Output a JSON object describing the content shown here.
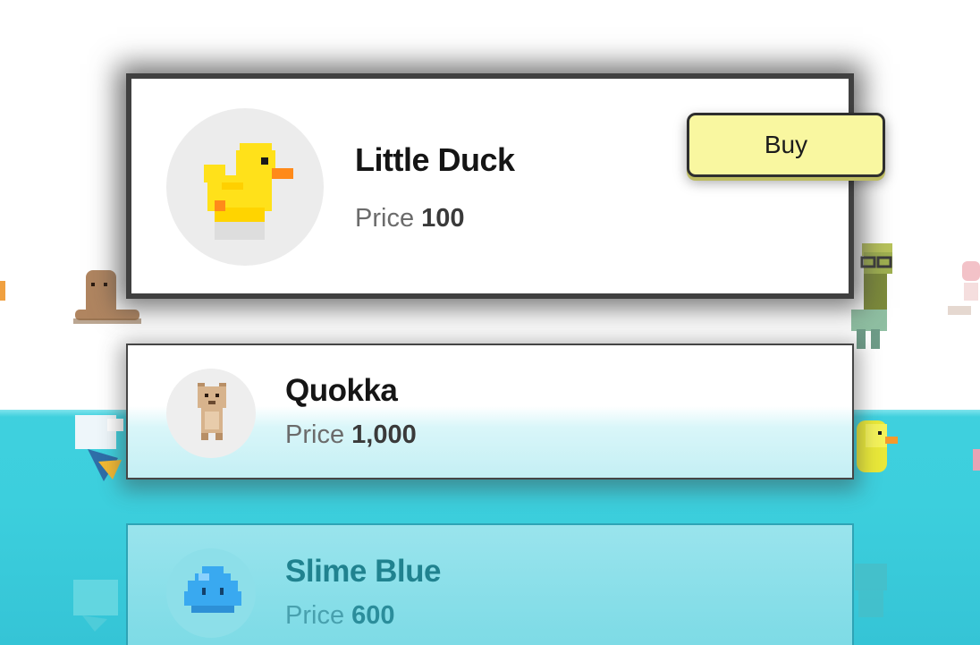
{
  "shop": {
    "items": [
      {
        "name": "Little Duck",
        "price_label": "Price",
        "price": "100",
        "icon": "duck-icon"
      },
      {
        "name": "Quokka",
        "price_label": "Price",
        "price": "1,000",
        "icon": "quokka-icon"
      },
      {
        "name": "Slime Blue",
        "price_label": "Price",
        "price": "600",
        "icon": "slime-blue-icon"
      }
    ],
    "buy_label": "Buy"
  },
  "colors": {
    "water": "#3fd0de",
    "buy_button": "#f9f7a0",
    "duck_yellow": "#ffe11a",
    "duck_beak": "#ff8a1a",
    "slime_blue": "#3aa8f2",
    "quokka_tan": "#d7b38c"
  }
}
